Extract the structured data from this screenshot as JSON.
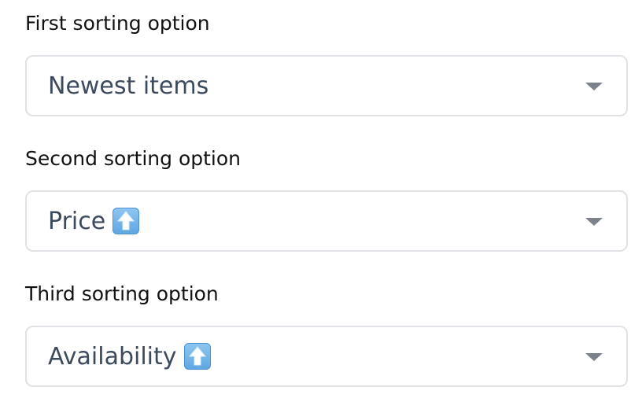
{
  "sort_options": [
    {
      "label": "First sorting option",
      "selected": "Newest items",
      "direction_icon": null
    },
    {
      "label": "Second sorting option",
      "selected": "Price",
      "direction_icon": "up-arrow-button-icon"
    },
    {
      "label": "Third sorting option",
      "selected": "Availability",
      "direction_icon": "up-arrow-button-icon"
    }
  ],
  "colors": {
    "label_text": "#111111",
    "value_text": "#3c4a5e",
    "border": "#dfe2e6",
    "chevron": "#7b828c",
    "emoji_blue": "#6aaee6"
  }
}
